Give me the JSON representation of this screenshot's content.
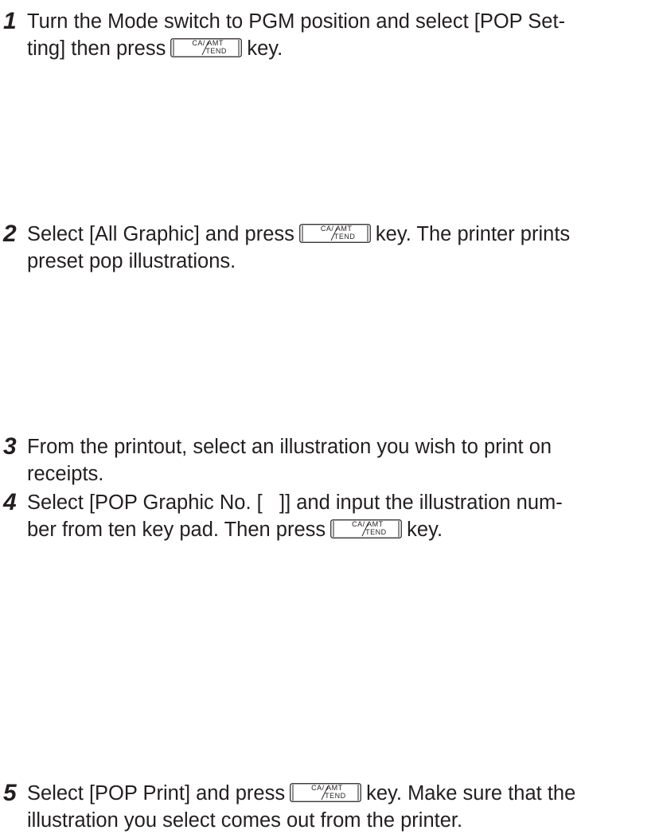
{
  "key": {
    "name": "CA/AMT TEND",
    "top_label": "CA/ AMT",
    "bottom_label": "TEND"
  },
  "steps": [
    {
      "number": "1",
      "line1_before": "Turn the Mode switch to PGM position and select [POP Set-",
      "line2_before": "ting] then press",
      "line2_after": "key."
    },
    {
      "number": "2",
      "line1_before": "Select [All Graphic] and press",
      "line1_after": "key. The printer prints",
      "line2": "preset pop illustrations."
    },
    {
      "number": "3",
      "line1": "From the printout, select an illustration you wish to print on",
      "line2": "receipts."
    },
    {
      "number": "4",
      "line1": "Select [POP Graphic No. [   ]] and input the illustration num-",
      "line2_before": "ber from ten key pad. Then press",
      "line2_after": "key."
    },
    {
      "number": "5",
      "line1_before": "Select [POP Print] and press",
      "line1_after": "key. Make sure that the",
      "line2": "illustration you select comes out from the printer."
    }
  ]
}
